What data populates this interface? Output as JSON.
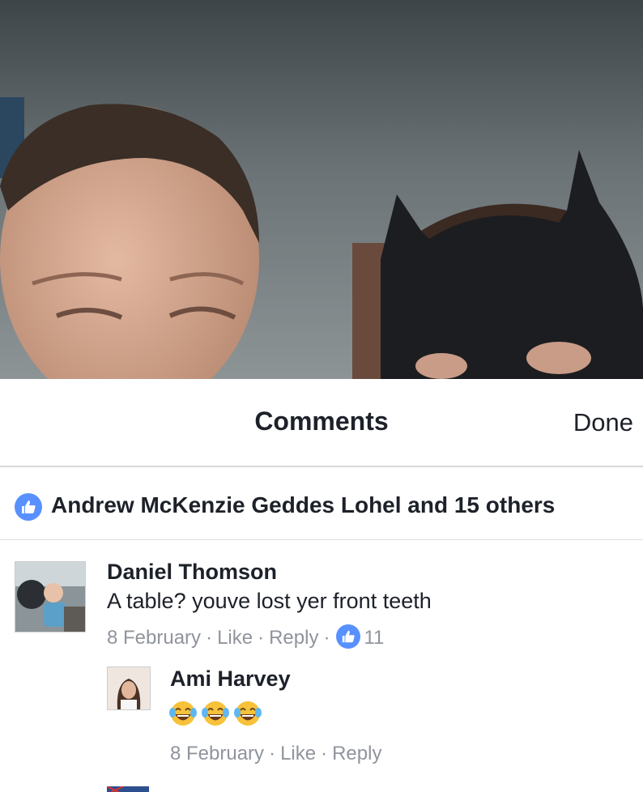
{
  "header": {
    "title": "Comments",
    "done_label": "Done"
  },
  "likes": {
    "icon": "thumbs-up-icon",
    "text": "Andrew McKenzie Geddes Lohel and 15 others"
  },
  "comments": [
    {
      "name": "Daniel Thomson",
      "text": "A table? youve lost yer front teeth",
      "date": "8 February",
      "like_label": "Like",
      "reply_label": "Reply",
      "reaction_count": "11"
    },
    {
      "name": "Ami Harvey",
      "emojis": [
        "face-with-tears-of-joy",
        "face-with-tears-of-joy",
        "face-with-tears-of-joy"
      ],
      "date": "8 February",
      "like_label": "Like",
      "reply_label": "Reply"
    }
  ],
  "colors": {
    "accent": "#5890ff",
    "meta_gray": "#90949c",
    "text_dark": "#1d2129"
  }
}
